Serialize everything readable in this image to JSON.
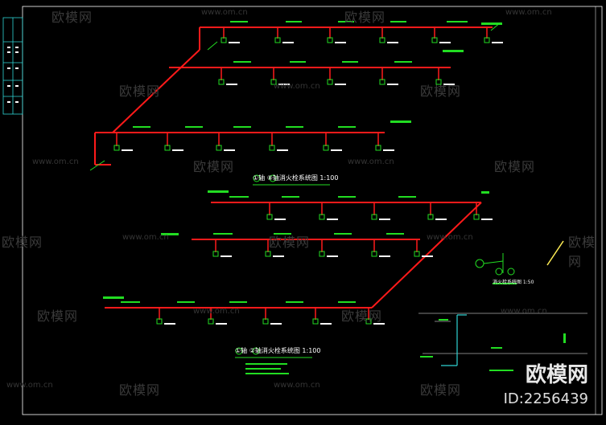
{
  "watermark": {
    "text": "欧模网",
    "url": "www.om.cn"
  },
  "brand": {
    "name": "欧模网",
    "id": "ID:2256439"
  },
  "colors": {
    "background": "#000000",
    "pipe": "#ff1a1a",
    "label": "#22dd22",
    "frame": "#2fd4d4",
    "white": "#ffffff"
  },
  "titles": {
    "upper": "①轴 ⑧轴消火栓系统图 1:100",
    "lower": "①轴 ②轴消火栓系统图 1:100",
    "detail": "消火栓系统图 1:50"
  },
  "pipe_label": "DN100",
  "hydrant_label": "SXL-1",
  "valve_label": "DN65"
}
